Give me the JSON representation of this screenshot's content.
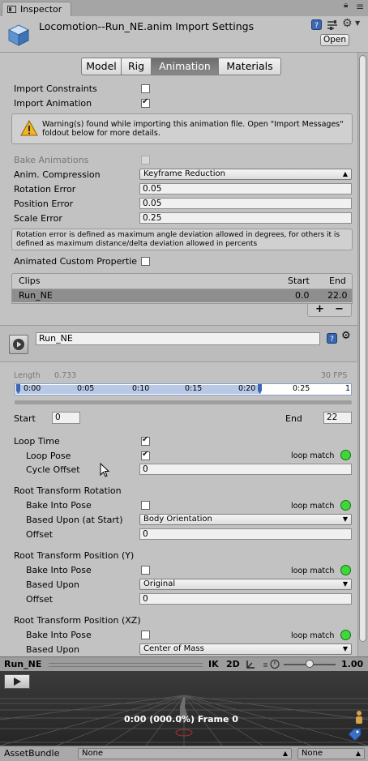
{
  "tab": {
    "label": "Inspector"
  },
  "header": {
    "title": "Locomotion--Run_NE.anim Import Settings",
    "open_label": "Open"
  },
  "toolbar": {
    "tabs": [
      "Model",
      "Rig",
      "Animation",
      "Materials"
    ],
    "active": "Animation"
  },
  "import": {
    "constraints_label": "Import Constraints",
    "constraints_checked": false,
    "animation_label": "Import Animation",
    "animation_checked": true,
    "warning": "Warning(s) found while importing this animation file. Open \"Import Messages\" foldout below for more details."
  },
  "bake": {
    "label": "Bake Animations"
  },
  "compression": {
    "label": "Anim. Compression",
    "value": "Keyframe Reduction",
    "rotation_error_label": "Rotation Error",
    "rotation_error": "0.05",
    "position_error_label": "Position Error",
    "position_error": "0.05",
    "scale_error_label": "Scale Error",
    "scale_error": "0.25",
    "help": "Rotation error is defined as maximum angle deviation allowed in degrees, for others it is defined as maximum distance/delta deviation allowed in percents"
  },
  "custom_props": {
    "label": "Animated Custom Propertie"
  },
  "clips": {
    "headers": {
      "name": "Clips",
      "start": "Start",
      "end": "End"
    },
    "rows": [
      {
        "name": "Run_NE",
        "start": "0.0",
        "end": "22.0"
      }
    ],
    "add": "+",
    "remove": "−"
  },
  "clip": {
    "name": "Run_NE"
  },
  "timeline": {
    "length_label": "Length",
    "length": "0.733",
    "fps": "30 FPS",
    "ticks": [
      "0:00",
      "0:05",
      "0:10",
      "0:15",
      "0:20",
      "0:25",
      "1"
    ]
  },
  "range": {
    "start_label": "Start",
    "start": "0",
    "end_label": "End",
    "end": "22"
  },
  "loop": {
    "loop_time": "Loop Time",
    "loop_pose": "Loop Pose",
    "loop_match": "loop match",
    "cycle_offset": "Cycle Offset",
    "cycle_offset_value": "0"
  },
  "rot": {
    "title": "Root Transform Rotation",
    "bake": "Bake Into Pose",
    "loop_match": "loop match",
    "based_upon": "Based Upon (at Start)",
    "based_value": "Body Orientation",
    "offset": "Offset",
    "offset_value": "0"
  },
  "posy": {
    "title": "Root Transform Position (Y)",
    "bake": "Bake Into Pose",
    "loop_match": "loop match",
    "based_upon": "Based Upon",
    "based_value": "Original",
    "offset": "Offset",
    "offset_value": "0"
  },
  "posxz": {
    "title": "Root Transform Position (XZ)",
    "bake": "Bake Into Pose",
    "loop_match": "loop match",
    "based_upon": "Based Upon",
    "based_value": "Center of Mass"
  },
  "preview": {
    "name": "Run_NE",
    "ik": "IK",
    "mode2d": "2D",
    "speed": "1.00",
    "frame": "0:00 (000.0%) Frame 0"
  },
  "assetbundle": {
    "label": "AssetBundle",
    "value1": "None",
    "value2": "None"
  },
  "colors": {
    "loop_match_ok": "#3fd83a",
    "active_tab": "#6d6d6d"
  }
}
